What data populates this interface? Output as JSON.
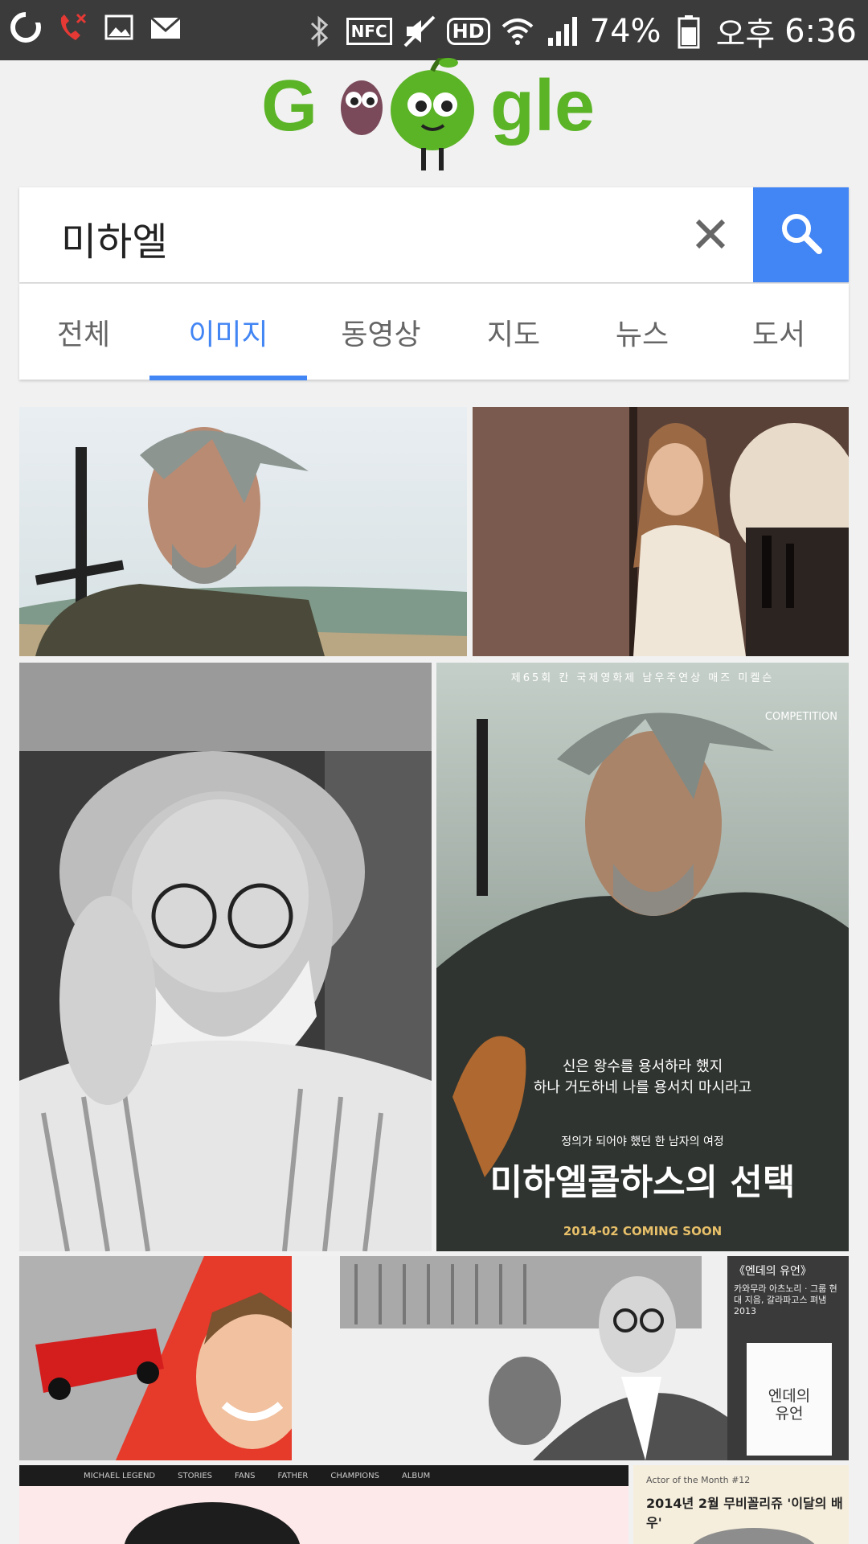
{
  "status_bar": {
    "battery": "74%",
    "ampm": "오후",
    "time": "6:36",
    "icons": [
      "app-icon",
      "missed-call-icon",
      "image-icon",
      "mail-icon",
      "bluetooth-icon",
      "nfc-icon",
      "mute-icon",
      "hd-icon",
      "wifi-icon",
      "signal-icon",
      "battery-icon"
    ],
    "nfc_label": "NFC",
    "hd_label": "HD"
  },
  "search": {
    "query": "미하엘",
    "accent": "#4285f4"
  },
  "tabs": [
    {
      "label": "전체",
      "active": false
    },
    {
      "label": "이미지",
      "active": true
    },
    {
      "label": "동영상",
      "active": false
    },
    {
      "label": "지도",
      "active": false
    },
    {
      "label": "뉴스",
      "active": false
    },
    {
      "label": "도서",
      "active": false
    }
  ],
  "results": {
    "poster": {
      "top_line": "제65회 칸 국제영화제 남우주연상 매즈 미켈슨",
      "festival": "COMPETITION",
      "tagline1": "신은 왕수를 용서하라 했지",
      "tagline2": "하나 거도하네 나를 용서치 마시라고",
      "subtitle": "정의가 되어야 했던 한 남자의 여정",
      "title": "미하엘콜하스의 선택",
      "release": "2014-02 COMING SOON"
    },
    "book": {
      "heading": "《엔데의 유언》",
      "desc": "카와무라 아츠노리 · 그룹 현대 지음, 갈라파고스 펴냄 2013",
      "cover_title": "엔데의 유언"
    },
    "magazine": {
      "label": "Actor of the Month #12",
      "headline": "2014년 2월 무비꼴리쥬 '이달의 배우'"
    },
    "site_nav": [
      "MICHAEL LEGEND",
      "STORIES",
      "FANS",
      "FATHER",
      "CHAMPIONS",
      "ALBUM"
    ]
  }
}
